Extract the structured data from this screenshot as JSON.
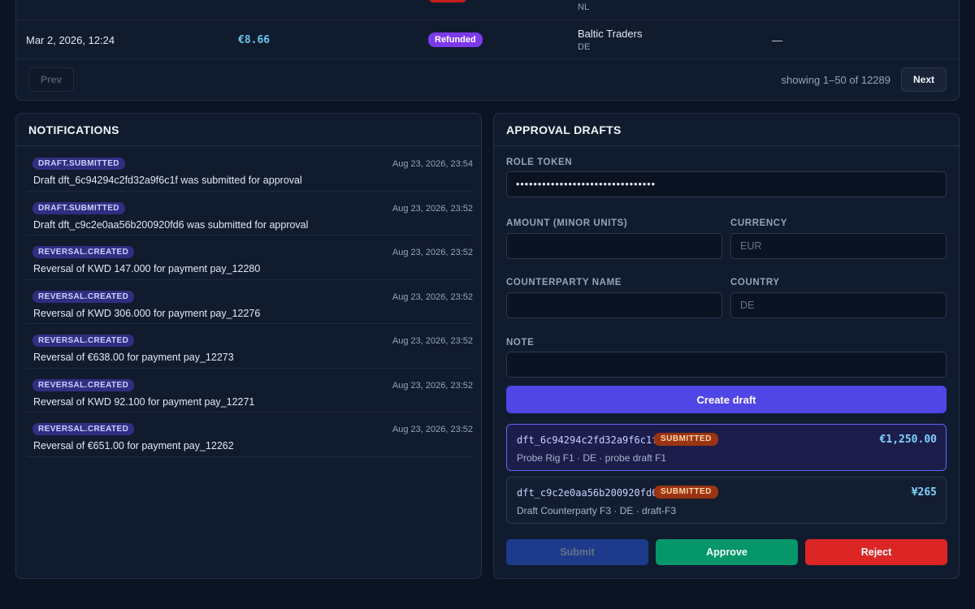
{
  "payments": {
    "partial_row": {
      "country": "NL"
    },
    "rows": [
      {
        "time": "Mar 2, 2026, 12:24",
        "amount": "€8.66",
        "status": "Refunded",
        "counterparty": "Baltic Traders",
        "country": "DE",
        "reference": "—"
      }
    ],
    "pager": {
      "prev_label": "Prev",
      "next_label": "Next",
      "showing": "showing 1–50 of 12289"
    }
  },
  "notifications": {
    "title": "NOTIFICATIONS",
    "items": [
      {
        "type": "DRAFT.SUBMITTED",
        "message": "Draft dft_6c94294c2fd32a9f6c1f was submitted for approval",
        "time": "Aug 23, 2026, 23:54"
      },
      {
        "type": "DRAFT.SUBMITTED",
        "message": "Draft dft_c9c2e0aa56b200920fd6 was submitted for approval",
        "time": "Aug 23, 2026, 23:52"
      },
      {
        "type": "REVERSAL.CREATED",
        "message": "Reversal of KWD 147.000 for payment pay_12280",
        "time": "Aug 23, 2026, 23:52"
      },
      {
        "type": "REVERSAL.CREATED",
        "message": "Reversal of KWD 306.000 for payment pay_12276",
        "time": "Aug 23, 2026, 23:52"
      },
      {
        "type": "REVERSAL.CREATED",
        "message": "Reversal of €638.00 for payment pay_12273",
        "time": "Aug 23, 2026, 23:52"
      },
      {
        "type": "REVERSAL.CREATED",
        "message": "Reversal of KWD 92.100 for payment pay_12271",
        "time": "Aug 23, 2026, 23:52"
      },
      {
        "type": "REVERSAL.CREATED",
        "message": "Reversal of €651.00 for payment pay_12262",
        "time": "Aug 23, 2026, 23:52"
      }
    ]
  },
  "drafts": {
    "title": "APPROVAL DRAFTS",
    "form": {
      "role_token_label": "ROLE TOKEN",
      "role_token_value": "••••••••••••••••••••••••••••••••",
      "amount_label": "AMOUNT (MINOR UNITS)",
      "amount_value": "",
      "currency_label": "CURRENCY",
      "currency_placeholder": "EUR",
      "counterparty_label": "COUNTERPARTY NAME",
      "counterparty_value": "",
      "country_label": "COUNTRY",
      "country_placeholder": "DE",
      "note_label": "NOTE",
      "note_value": "",
      "create_label": "Create draft"
    },
    "list": [
      {
        "id": "dft_6c94294c2fd32a9f6c1f",
        "status": "SUBMITTED",
        "amount": "€1,250.00",
        "meta": "Probe Rig F1 · DE · probe draft F1",
        "selected": true
      },
      {
        "id": "dft_c9c2e0aa56b200920fd6",
        "status": "SUBMITTED",
        "amount": "¥265",
        "meta": "Draft Counterparty F3 · DE · draft-F3",
        "selected": false
      }
    ],
    "actions": {
      "submit_label": "Submit",
      "approve_label": "Approve",
      "reject_label": "Reject"
    }
  },
  "colors": {
    "background": "#0c1424",
    "panel": "#111b2e",
    "accent": "#4f46e5",
    "approve": "#059669",
    "reject": "#dc2626",
    "refunded": "#7c3aed",
    "submitted_badge": "#9a3412"
  }
}
